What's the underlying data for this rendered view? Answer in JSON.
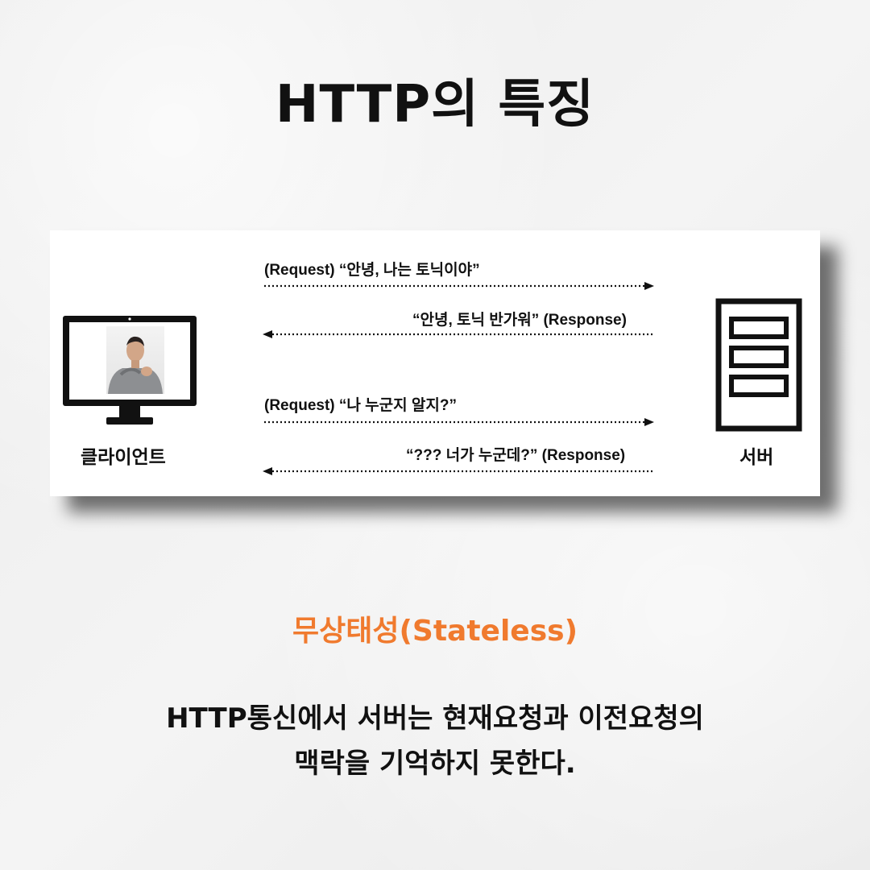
{
  "title": "HTTP의 특징",
  "diagram": {
    "client_label": "클라이언트",
    "server_label": "서버",
    "messages": [
      {
        "text": "(Request) “안녕, 나는 토닉이야”",
        "direction": "right"
      },
      {
        "text": "“안녕, 토닉 반가워” (Response)",
        "direction": "left"
      },
      {
        "text": "(Request) “나 누군지 알지?”",
        "direction": "right"
      },
      {
        "text": "“??? 너가 누군데?” (Response)",
        "direction": "left"
      }
    ]
  },
  "subtitle": "무상태성(Stateless)",
  "description": {
    "line1": "HTTP통신에서 서버는 현재요청과 이전요청의",
    "line2": "맥락을 기억하지 못한다."
  },
  "colors": {
    "accent": "#f07a2e",
    "text": "#111111",
    "background": "#efefef"
  }
}
